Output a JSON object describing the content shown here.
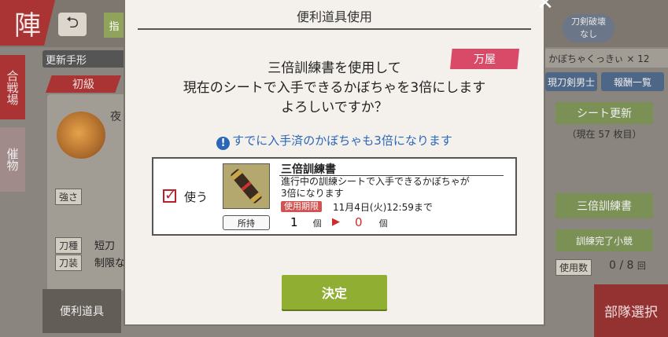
{
  "background": {
    "jin_label": "陣",
    "back_icon": "return-arrow-icon",
    "green_tab": "指",
    "refresh_label": "更新手形",
    "level_tab": "初級",
    "side_tab_battle": "合戦場",
    "side_tab_items": "催物",
    "strength_label": "強さ",
    "weapon_type_label": "刀種",
    "weapon_type_value": "短刀",
    "equipment_label": "刀装",
    "equipment_value": "制限な",
    "night_label": "夜",
    "convenient_items": "便利道具",
    "right_top_badge": "刀剣破壊\nなし",
    "pumpkin_count": "かぼちゃくっきぃ × 12",
    "swords_button": "現刀剣男士",
    "rewards_button": "報酬一覧",
    "sheet_update_button": "シート更新",
    "sheet_status": "（現在 57 枚目）",
    "triple_training_button": "三倍訓練書",
    "training_complete_button": "訓練完了小競",
    "used_label": "使用数",
    "used_count": "0 / 8",
    "used_unit": "回",
    "unit_select_button": "部隊選択"
  },
  "modal": {
    "title": "便利道具使用",
    "close_icon": "close-x-icon",
    "shop_tag": "万屋",
    "message_line1": "三倍訓練書を使用して",
    "message_line2": "現在のシートで入手できるかぼちゃを3倍にします",
    "message_line3": "よろしいですか？",
    "notice_icon": "exclamation-info-icon",
    "notice": "すでに入手済のかぼちゃも3倍になります",
    "item": {
      "checked": true,
      "use_label": "使う",
      "name": "三倍訓練書",
      "description_line1": "進行中の訓練シートで入手できるかぼちゃが",
      "description_line2": "3倍になります",
      "period_badge": "使用期限",
      "expiry": "11月4日(火)12:59まで",
      "held_label": "所持",
      "count_before": "1",
      "unit": "個",
      "count_after": "0",
      "image_icon": "scroll-icon"
    },
    "confirm_button": "決定"
  },
  "colors": {
    "accent_green": "#8fae32",
    "notice_blue": "#2a67b8",
    "tag_pink": "#d84a68",
    "accent_red": "#a33"
  }
}
